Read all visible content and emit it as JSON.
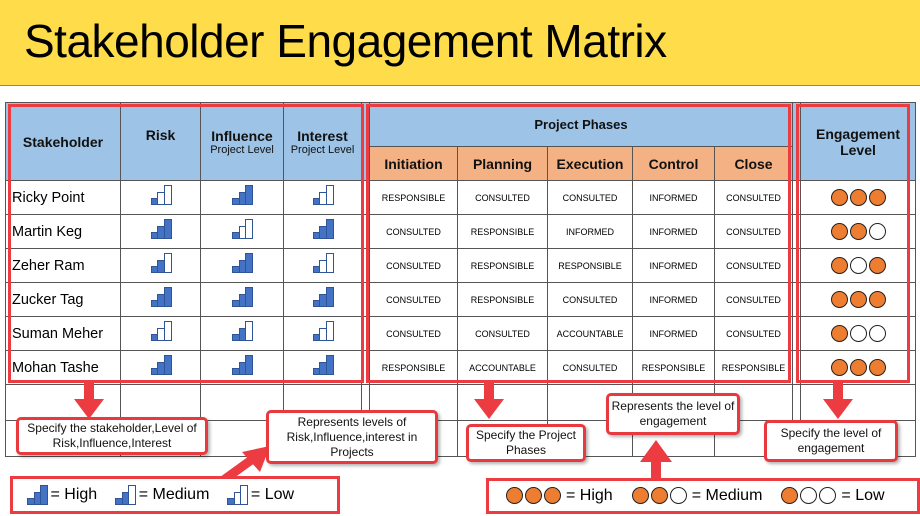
{
  "title": "Stakeholder Engagement Matrix",
  "headers": {
    "stakeholder": "Stakeholder",
    "risk": "Risk",
    "influence": "Influence",
    "influence_sub": "Project Level",
    "interest": "Interest",
    "interest_sub": "Project Level",
    "project_phases": "Project Phases",
    "phases": [
      "Initiation",
      "Planning",
      "Execution",
      "Control",
      "Close"
    ],
    "engagement": "Engagement Level"
  },
  "rows": [
    {
      "name": "Ricky Point",
      "risk": "Low",
      "influence": "High",
      "interest": "Low",
      "phases": [
        "RESPONSIBLE",
        "CONSULTED",
        "CONSULTED",
        "INFORMED",
        "CONSULTED"
      ],
      "engagement": "High"
    },
    {
      "name": "Martin Keg",
      "risk": "High",
      "influence": "Low",
      "interest": "High",
      "phases": [
        "CONSULTED",
        "RESPONSIBLE",
        "INFORMED",
        "INFORMED",
        "CONSULTED"
      ],
      "engagement": "Medium"
    },
    {
      "name": "Zeher Ram",
      "risk": "Medium",
      "influence": "High",
      "interest": "Low",
      "phases": [
        "CONSULTED",
        "RESPONSIBLE",
        "RESPONSIBLE",
        "INFORMED",
        "CONSULTED"
      ],
      "engagement": "Medium-Alt"
    },
    {
      "name": "Zucker Tag",
      "risk": "High",
      "influence": "High",
      "interest": "High",
      "phases": [
        "CONSULTED",
        "RESPONSIBLE",
        "CONSULTED",
        "INFORMED",
        "CONSULTED"
      ],
      "engagement": "High"
    },
    {
      "name": "Suman Meher",
      "risk": "Low",
      "influence": "Medium",
      "interest": "Low",
      "phases": [
        "CONSULTED",
        "CONSULTED",
        "ACCOUNTABLE",
        "INFORMED",
        "CONSULTED"
      ],
      "engagement": "Low"
    },
    {
      "name": "Mohan Tashe",
      "risk": "High",
      "influence": "High",
      "interest": "High",
      "phases": [
        "RESPONSIBLE",
        "ACCOUNTABLE",
        "CONSULTED",
        "RESPONSIBLE",
        "RESPONSIBLE"
      ],
      "engagement": "High"
    }
  ],
  "engagement_dots": {
    "High": [
      1,
      1,
      1
    ],
    "Medium": [
      1,
      1,
      0
    ],
    "Medium-Alt": [
      1,
      0,
      1
    ],
    "Low": [
      1,
      0,
      0
    ]
  },
  "callouts": {
    "stakeholder": "Specify the stakeholder,Level of Risk,Influence,Interest",
    "levels": "Represents levels of Risk,Influence,interest in Projects",
    "phases": "Specify the Project Phases",
    "engagement_rep": "Represents the level of engagement",
    "engagement_spec": "Specify the level of engagement"
  },
  "legend_bars": [
    {
      "level": "High",
      "label": "= High"
    },
    {
      "level": "Medium",
      "label": "= Medium"
    },
    {
      "level": "Low",
      "label": "= Low"
    }
  ],
  "legend_dots": [
    {
      "level": "High",
      "label": "= High"
    },
    {
      "level": "Medium",
      "label": "= Medium"
    },
    {
      "level": "Low",
      "label": "= Low"
    }
  ],
  "colors": {
    "title_bg": "#fedc4a",
    "header_blue": "#9dc3e6",
    "phase_orange": "#f4b183",
    "bar_blue": "#4472c4",
    "dot_orange": "#ed7d31",
    "highlight_red": "#ed3c41"
  }
}
